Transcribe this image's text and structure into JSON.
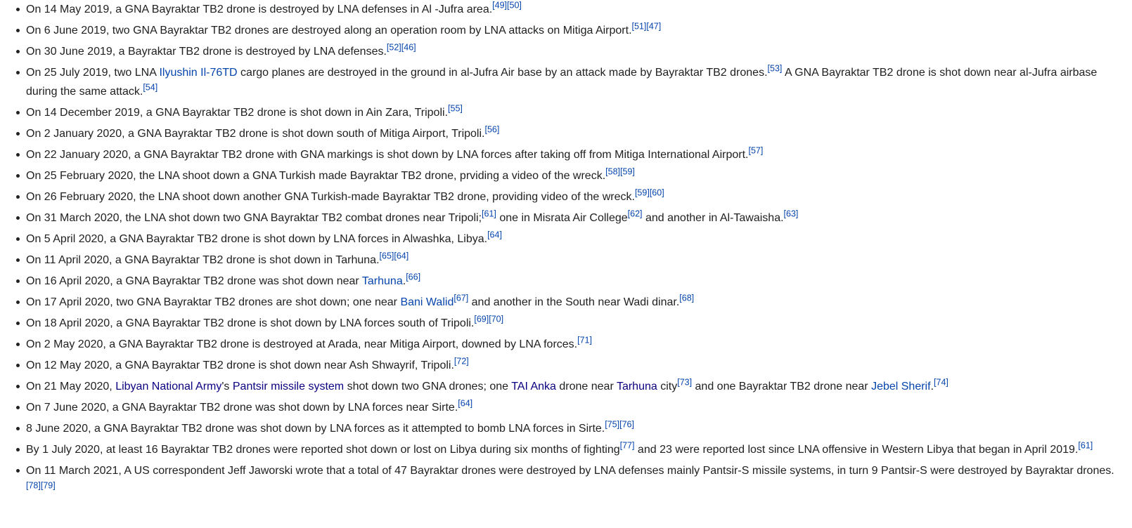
{
  "items": [
    [
      {
        "t": "text",
        "v": "On 14 May 2019, a GNA Bayraktar TB2 drone is destroyed by LNA defenses in Al -Jufra area."
      },
      {
        "t": "ref",
        "v": "[49]"
      },
      {
        "t": "ref",
        "v": "[50]"
      }
    ],
    [
      {
        "t": "text",
        "v": "On 6 June 2019, two GNA Bayraktar TB2 drones are destroyed along an operation room by LNA attacks on Mitiga Airport."
      },
      {
        "t": "ref",
        "v": "[51]"
      },
      {
        "t": "ref",
        "v": "[47]"
      }
    ],
    [
      {
        "t": "text",
        "v": "On 30 June 2019, a Bayraktar TB2 drone is destroyed by LNA defenses."
      },
      {
        "t": "ref",
        "v": "[52]"
      },
      {
        "t": "ref",
        "v": "[46]"
      }
    ],
    [
      {
        "t": "text",
        "v": "On 25 July 2019, two LNA "
      },
      {
        "t": "link",
        "v": "Ilyushin Il-76TD"
      },
      {
        "t": "text",
        "v": " cargo planes are destroyed in the ground in al-Jufra Air base by an attack made by Bayraktar TB2 drones."
      },
      {
        "t": "ref",
        "v": "[53]"
      },
      {
        "t": "text",
        "v": " A GNA Bayraktar TB2 drone is shot down near al-Jufra airbase during the same attack."
      },
      {
        "t": "ref",
        "v": "[54]"
      }
    ],
    [
      {
        "t": "text",
        "v": "On 14 December 2019, a GNA Bayraktar TB2 drone is shot down in Ain Zara, Tripoli."
      },
      {
        "t": "ref",
        "v": "[55]"
      }
    ],
    [
      {
        "t": "text",
        "v": "On 2 January 2020, a GNA Bayraktar TB2 drone is shot down south of Mitiga Airport, Tripoli."
      },
      {
        "t": "ref",
        "v": "[56]"
      }
    ],
    [
      {
        "t": "text",
        "v": "On 22 January 2020, a GNA Bayraktar TB2 drone with GNA markings is shot down by LNA forces after taking off from Mitiga International Airport."
      },
      {
        "t": "ref",
        "v": "[57]"
      }
    ],
    [
      {
        "t": "text",
        "v": "On 25 February 2020, the LNA shoot down a GNA Turkish made Bayraktar TB2 drone, prviding a video of the wreck."
      },
      {
        "t": "ref",
        "v": "[58]"
      },
      {
        "t": "ref",
        "v": "[59]"
      }
    ],
    [
      {
        "t": "text",
        "v": "On 26 February 2020, the LNA shoot down another GNA Turkish-made Bayraktar TB2 drone, providing video of the wreck."
      },
      {
        "t": "ref",
        "v": "[59]"
      },
      {
        "t": "ref",
        "v": "[60]"
      }
    ],
    [
      {
        "t": "text",
        "v": "On 31 March 2020, the LNA shot down two GNA Bayraktar TB2 combat drones near Tripoli;"
      },
      {
        "t": "ref",
        "v": "[61]"
      },
      {
        "t": "text",
        "v": " one in Misrata Air College"
      },
      {
        "t": "ref",
        "v": "[62]"
      },
      {
        "t": "text",
        "v": " and another in Al-Tawaisha."
      },
      {
        "t": "ref",
        "v": "[63]"
      }
    ],
    [
      {
        "t": "text",
        "v": "On 5 April 2020, a GNA Bayraktar TB2 drone is shot down by LNA forces in Alwashka, Libya."
      },
      {
        "t": "ref",
        "v": "[64]"
      }
    ],
    [
      {
        "t": "text",
        "v": "On 11 April 2020, a GNA Bayraktar TB2 drone is shot down in Tarhuna."
      },
      {
        "t": "ref",
        "v": "[65]"
      },
      {
        "t": "ref",
        "v": "[64]"
      }
    ],
    [
      {
        "t": "text",
        "v": "On 16 April 2020, a GNA Bayraktar TB2 drone was shot down near "
      },
      {
        "t": "link",
        "v": "Tarhuna"
      },
      {
        "t": "text",
        "v": "."
      },
      {
        "t": "ref",
        "v": "[66]"
      }
    ],
    [
      {
        "t": "text",
        "v": "On 17 April 2020, two GNA Bayraktar TB2 drones are shot down; one near "
      },
      {
        "t": "link",
        "v": "Bani Walid"
      },
      {
        "t": "ref",
        "v": "[67]"
      },
      {
        "t": "text",
        "v": " and another in the South near Wadi dinar."
      },
      {
        "t": "ref",
        "v": "[68]"
      }
    ],
    [
      {
        "t": "text",
        "v": "On 18 April 2020, a GNA Bayraktar TB2 drone is shot down by LNA forces south of Tripoli."
      },
      {
        "t": "ref",
        "v": "[69]"
      },
      {
        "t": "ref",
        "v": "[70]"
      }
    ],
    [
      {
        "t": "text",
        "v": "On 2 May 2020, a GNA Bayraktar TB2 drone is destroyed at Arada, near Mitiga Airport, downed by LNA forces."
      },
      {
        "t": "ref",
        "v": "[71]"
      }
    ],
    [
      {
        "t": "text",
        "v": "On 12 May 2020, a GNA Bayraktar TB2 drone is shot down near Ash Shwayrif, Tripoli."
      },
      {
        "t": "ref",
        "v": "[72]"
      }
    ],
    [
      {
        "t": "text",
        "v": "On 21 May 2020, "
      },
      {
        "t": "vlink",
        "v": "Libyan National Army"
      },
      {
        "t": "text",
        "v": "'s "
      },
      {
        "t": "vlink",
        "v": "Pantsir missile system"
      },
      {
        "t": "text",
        "v": " shot down two GNA drones; one "
      },
      {
        "t": "vlink",
        "v": "TAI Anka"
      },
      {
        "t": "text",
        "v": " drone near "
      },
      {
        "t": "vlink",
        "v": "Tarhuna"
      },
      {
        "t": "text",
        "v": " city"
      },
      {
        "t": "ref",
        "v": "[73]"
      },
      {
        "t": "text",
        "v": " and one Bayraktar TB2 drone near "
      },
      {
        "t": "link",
        "v": "Jebel Sherif"
      },
      {
        "t": "text",
        "v": "."
      },
      {
        "t": "ref",
        "v": "[74]"
      }
    ],
    [
      {
        "t": "text",
        "v": "On 7 June 2020, a GNA Bayraktar TB2 drone was shot down by LNA forces near Sirte."
      },
      {
        "t": "ref",
        "v": "[64]"
      }
    ],
    [
      {
        "t": "text",
        "v": "8 June 2020, a GNA Bayraktar TB2 drone was shot down by LNA forces as it attempted to bomb LNA forces in Sirte."
      },
      {
        "t": "ref",
        "v": "[75]"
      },
      {
        "t": "ref",
        "v": "[76]"
      }
    ],
    [
      {
        "t": "text",
        "v": "By 1 July 2020, at least 16 Bayraktar TB2 drones were reported shot down or lost on Libya during six months of fighting"
      },
      {
        "t": "ref",
        "v": "[77]"
      },
      {
        "t": "text",
        "v": " and 23 were reported lost since LNA offensive in Western Libya that began in April 2019."
      },
      {
        "t": "ref",
        "v": "[61]"
      }
    ],
    [
      {
        "t": "text",
        "v": "On 11 March 2021, A US correspondent Jeff Jaworski wrote that a total of 47 Bayraktar drones were destroyed by LNA defenses mainly Pantsir-S missile systems, in turn 9 Pantsir-S were destroyed by Bayraktar drones."
      },
      {
        "t": "ref",
        "v": "[78]"
      },
      {
        "t": "ref",
        "v": "[79]"
      }
    ]
  ]
}
